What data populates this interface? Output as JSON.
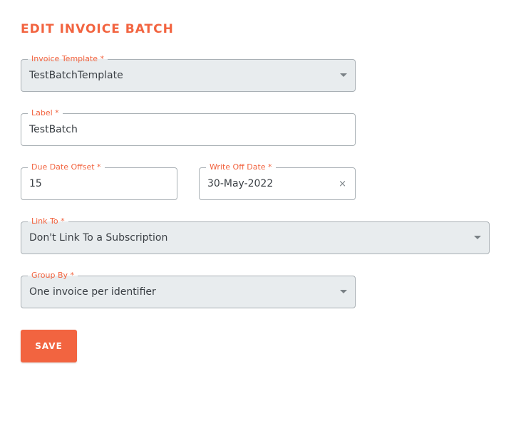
{
  "page": {
    "title": "EDIT INVOICE BATCH"
  },
  "form": {
    "invoice_template": {
      "label": "Invoice Template *",
      "value": "TestBatchTemplate"
    },
    "label_field": {
      "label": "Label *",
      "value": "TestBatch"
    },
    "due_date_offset": {
      "label": "Due Date Offset *",
      "value": "15"
    },
    "write_off_date": {
      "label": "Write Off Date *",
      "value": "30-May-2022",
      "clear_icon": "×"
    },
    "link_to": {
      "label": "Link To *",
      "value": "Don't Link To a Subscription"
    },
    "group_by": {
      "label": "Group By *",
      "value": "One invoice per identifier"
    }
  },
  "actions": {
    "save_label": "SAVE"
  },
  "colors": {
    "accent": "#f26440",
    "select_bg": "#e8ecee",
    "border": "#a9b0b5"
  },
  "icons": {
    "dropdown": "chevron-down-icon",
    "clear": "clear-icon"
  }
}
